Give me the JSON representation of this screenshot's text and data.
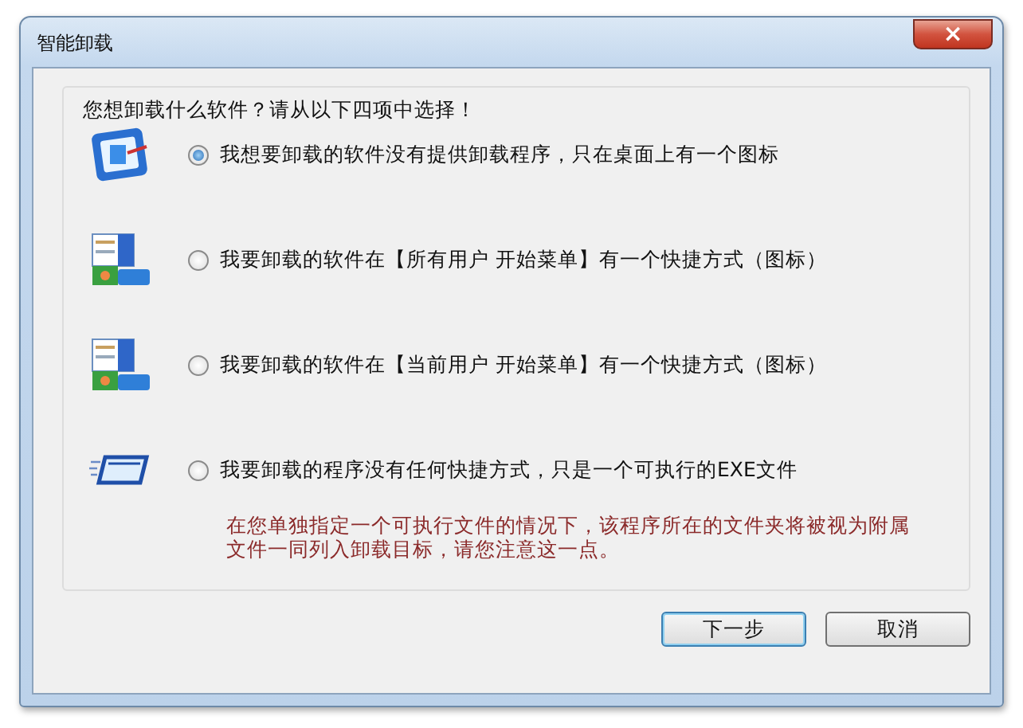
{
  "window": {
    "title": "智能卸载",
    "close": "×"
  },
  "heading": "您想卸载什么软件？请从以下四项中选择！",
  "options": [
    {
      "kind": "desktop",
      "label": "我想要卸载的软件没有提供卸载程序，只在桌面上有一个图标",
      "selected": true
    },
    {
      "kind": "startmenu",
      "label": "我要卸载的软件在【所有用户 开始菜单】有一个快捷方式（图标）",
      "selected": false
    },
    {
      "kind": "startmenu",
      "label": "我要卸载的软件在【当前用户 开始菜单】有一个快捷方式（图标）",
      "selected": false
    },
    {
      "kind": "exe",
      "label": "我要卸载的程序没有任何快捷方式，只是一个可执行的EXE文件",
      "selected": false
    }
  ],
  "note": "在您单独指定一个可执行文件的情况下，该程序所在的文件夹将被视为附属文件一同列入卸载目标，请您注意这一点。",
  "buttons": [
    {
      "label": "下一步",
      "default": true
    },
    {
      "label": "取消",
      "default": false
    }
  ]
}
